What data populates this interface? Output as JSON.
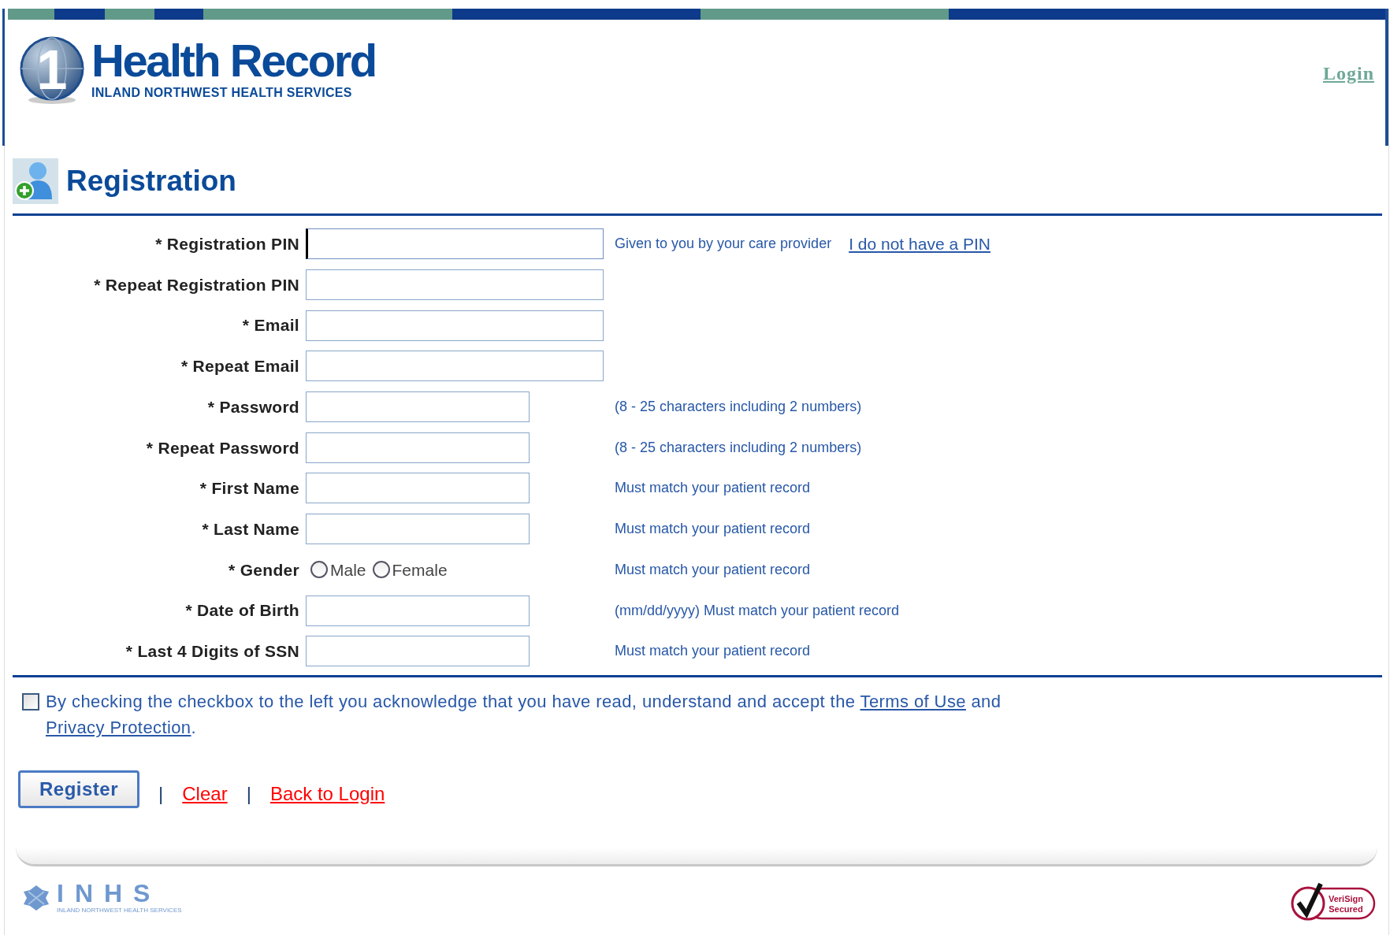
{
  "header": {
    "logo_mark": "1",
    "logo_title": "Health Record",
    "logo_subtitle": "INLAND NORTHWEST HEALTH SERVICES",
    "login_link": "Login"
  },
  "page_title": "Registration",
  "fields": [
    {
      "label": "* Registration PIN",
      "kind": "long-input",
      "focused": true,
      "hint": "Given to you by your care provider",
      "link": "I do not have a PIN"
    },
    {
      "label": "* Repeat Registration PIN",
      "kind": "long-input",
      "focused": false
    },
    {
      "label": "* Email",
      "kind": "long-input",
      "focused": false
    },
    {
      "label": "* Repeat Email",
      "kind": "long-input",
      "focused": false
    },
    {
      "label": "* Password",
      "kind": "short-input",
      "focused": false,
      "hint": "(8 - 25 characters including 2 numbers)"
    },
    {
      "label": "* Repeat Password",
      "kind": "short-input",
      "focused": false,
      "hint": "(8 - 25 characters including 2 numbers)"
    },
    {
      "label": "* First Name",
      "kind": "short-input",
      "focused": false,
      "hint": "Must match your patient record"
    },
    {
      "label": "* Last Name",
      "kind": "short-input",
      "focused": false,
      "hint": "Must match your patient record"
    },
    {
      "label": "* Gender",
      "kind": "radio",
      "options": [
        {
          "label": "Male",
          "selected": false
        },
        {
          "label": "Female",
          "selected": false
        }
      ],
      "hint": "Must match your patient record"
    },
    {
      "label": "* Date of Birth",
      "kind": "short-input",
      "focused": false,
      "hint": "(mm/dd/yyyy) Must match your patient record"
    },
    {
      "label": "* Last 4 Digits of SSN",
      "kind": "short-input",
      "focused": false,
      "hint": "Must match your patient record"
    }
  ],
  "agreement": {
    "checked": false,
    "parts": [
      {
        "kind": "text",
        "text": "By checking the checkbox to the left you acknowledge that you have read, understand and accept the "
      },
      {
        "kind": "link",
        "text": "Terms of Use"
      },
      {
        "kind": "text",
        "text": " and "
      },
      {
        "kind": "link",
        "text": "Privacy Protection"
      },
      {
        "kind": "text",
        "text": "."
      }
    ]
  },
  "actions": [
    {
      "kind": "button",
      "label": "Register"
    },
    {
      "kind": "separator",
      "label": "|"
    },
    {
      "kind": "link",
      "label": "Clear"
    },
    {
      "kind": "separator",
      "label": "|"
    },
    {
      "kind": "link",
      "label": "Back to Login"
    }
  ],
  "footer": {
    "org_logo": "INHS",
    "org_subtitle": "INLAND NORTHWEST HEALTH SERVICES",
    "seal_line1": "VeriSign",
    "seal_line2": "Secured"
  }
}
